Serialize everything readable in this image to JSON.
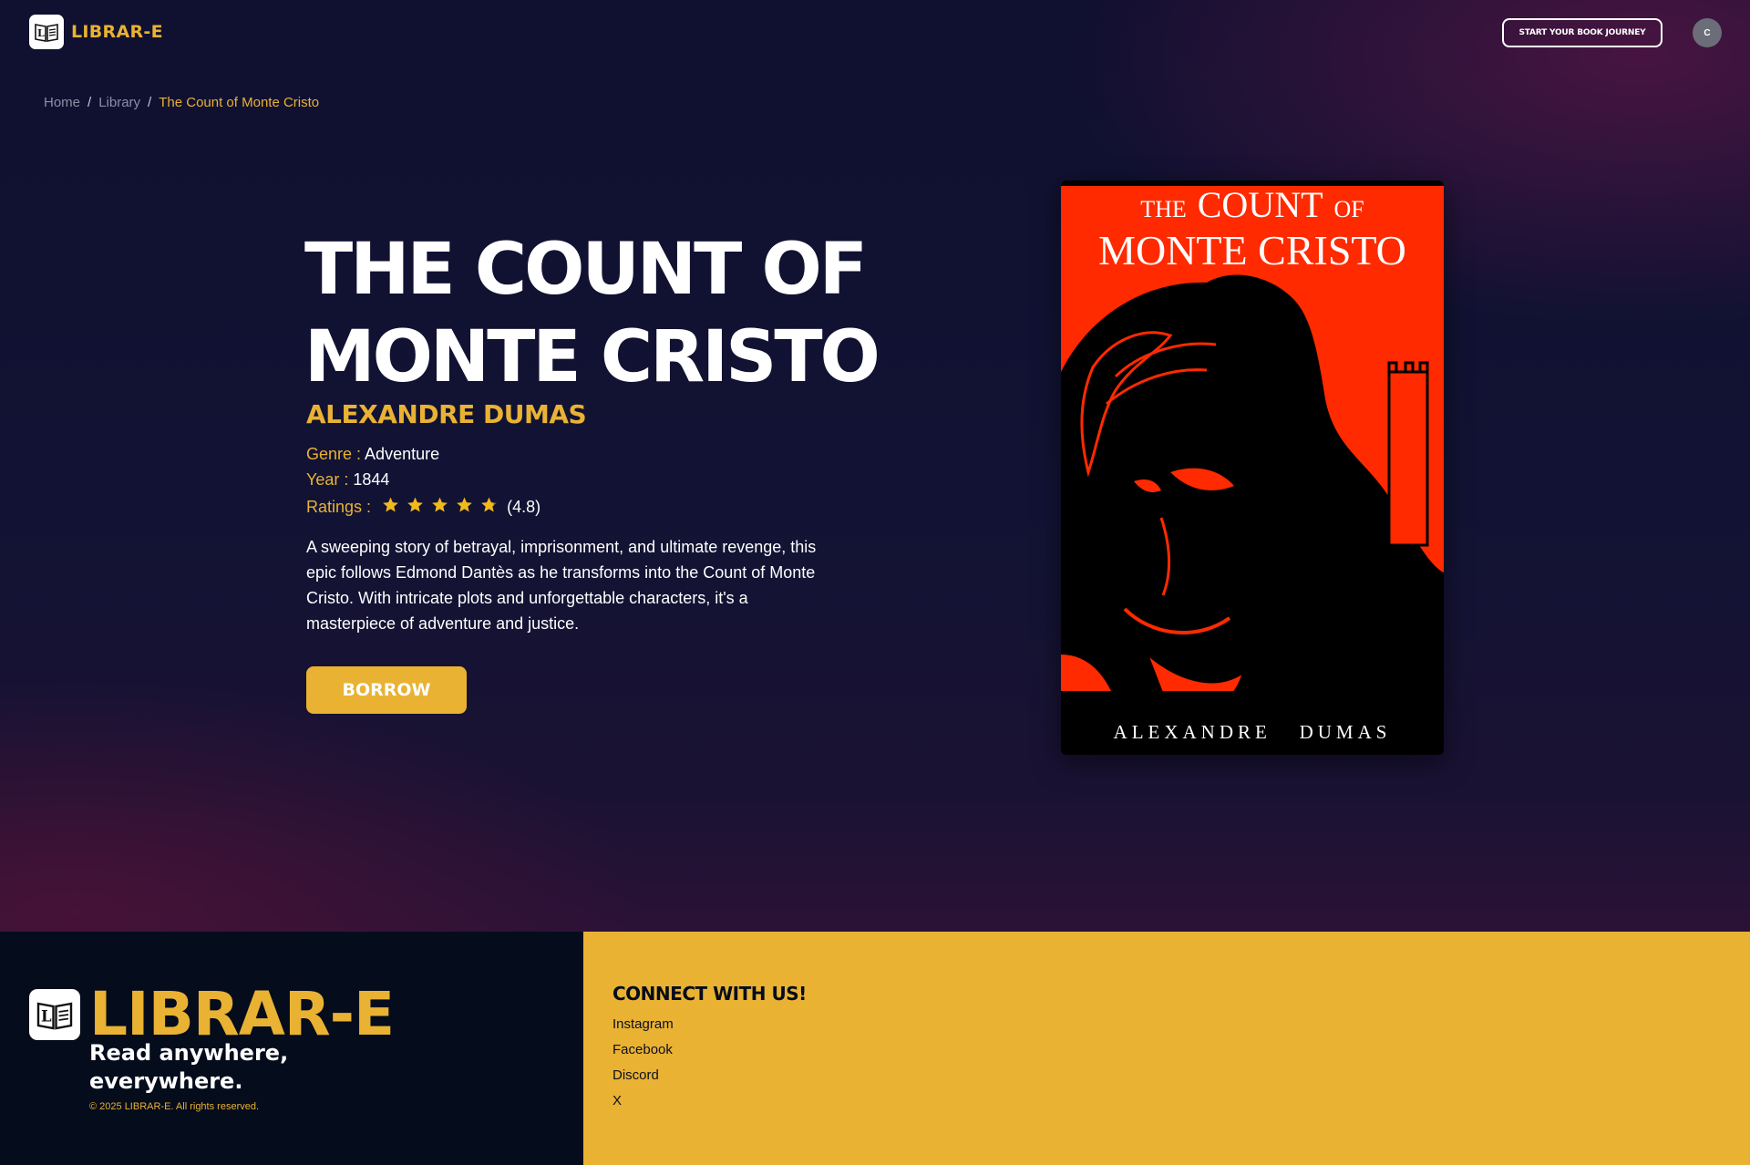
{
  "nav": {
    "brand": "LIBRAR-E",
    "cta_label": "START YOUR BOOK JOURNEY",
    "avatar_initial": "C"
  },
  "breadcrumb": {
    "home": "Home",
    "sep": "/",
    "library": "Library",
    "current": "The Count of Monte Cristo"
  },
  "book": {
    "title": "THE COUNT OF MONTE CRISTO",
    "author": "ALEXANDRE DUMAS",
    "genre_label": "Genre :",
    "genre": "Adventure",
    "year_label": "Year :",
    "year": "1844",
    "ratings_label": "Ratings :",
    "rating_text": "(4.8)",
    "rating_value": 4.8,
    "rating_max": 5,
    "description": "A sweeping story of betrayal, imprisonment, and ultimate revenge, this epic follows Edmond Dantès as he transforms into the Count of Monte Cristo. With intricate plots and unforgettable characters, it's a masterpiece of adventure and justice.",
    "borrow_label": "BORROW",
    "cover": {
      "title_line1_small": "THE",
      "title_line1_big": "COUNT",
      "title_line1_of": "OF",
      "title_line2": "MONTE CRISTO",
      "author": "ALEXANDRE   DUMAS",
      "bg_color": "#ff2a00"
    }
  },
  "footer": {
    "brand": "LIBRAR-E",
    "tagline": "Read anywhere, everywhere.",
    "copyright": "© 2025 LIBRAR-E. All rights reserved.",
    "connect_title": "CONNECT WITH US!",
    "social": [
      "Instagram",
      "Facebook",
      "Discord",
      "X"
    ]
  },
  "colors": {
    "accent": "#e9b233",
    "footer_dark": "#050c1c",
    "bg": "#101030"
  },
  "icons": {
    "logo": "open-book-icon",
    "star": "star-icon"
  }
}
